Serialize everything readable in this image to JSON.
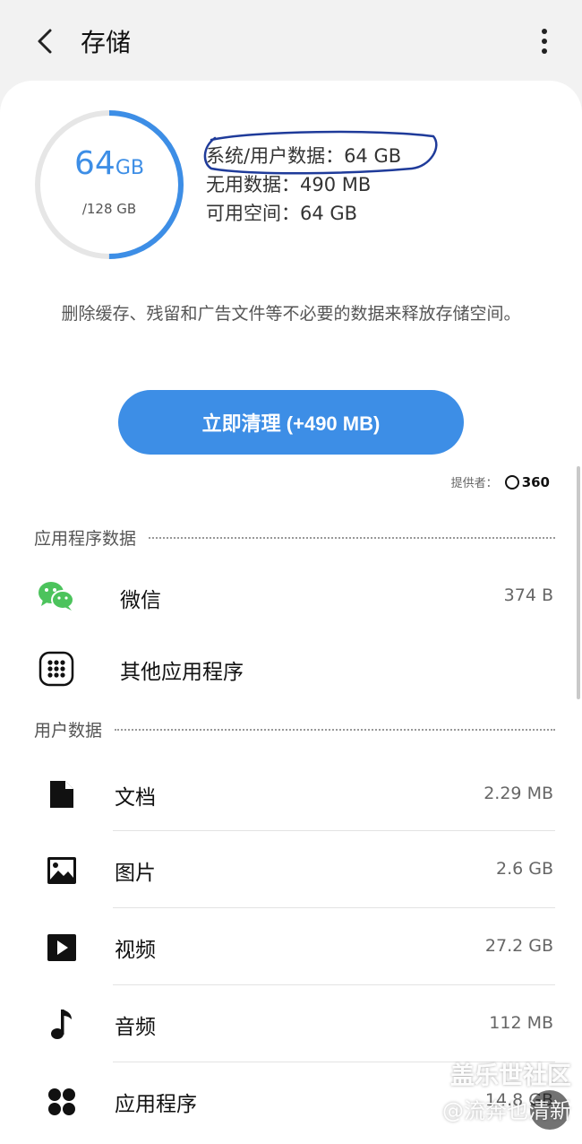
{
  "header": {
    "title": "存储"
  },
  "storage": {
    "used_number": "64",
    "used_unit": "GB",
    "total": "/128 GB",
    "used_fraction": 0.5,
    "accent_color": "#3d8ee6",
    "stats": [
      "系统/用户数据：64 GB",
      "无用数据：490 MB",
      "可用空间：64 GB"
    ]
  },
  "description": "删除缓存、残留和广告文件等不必要的数据来释放存储空间。",
  "clean_button": "立即清理 (+490 MB)",
  "provider": {
    "label": "提供者：",
    "name": "360"
  },
  "app_section": {
    "title": "应用程序数据",
    "items": [
      {
        "name": "微信",
        "size": "374 B",
        "icon": "wechat-icon"
      },
      {
        "name": "其他应用程序",
        "size": "",
        "icon": "apps-grid-icon"
      }
    ]
  },
  "user_section": {
    "title": "用户数据",
    "items": [
      {
        "name": "文档",
        "size": "2.29 MB",
        "icon": "document-icon"
      },
      {
        "name": "图片",
        "size": "2.6 GB",
        "icon": "image-icon"
      },
      {
        "name": "视频",
        "size": "27.2 GB",
        "icon": "video-icon"
      },
      {
        "name": "音频",
        "size": "112 MB",
        "icon": "music-icon"
      },
      {
        "name": "应用程序",
        "size": "14.8 GB",
        "icon": "apps-icon"
      }
    ]
  },
  "watermark": {
    "line1": "盖乐世社区",
    "line2": "@流奔也清新"
  }
}
